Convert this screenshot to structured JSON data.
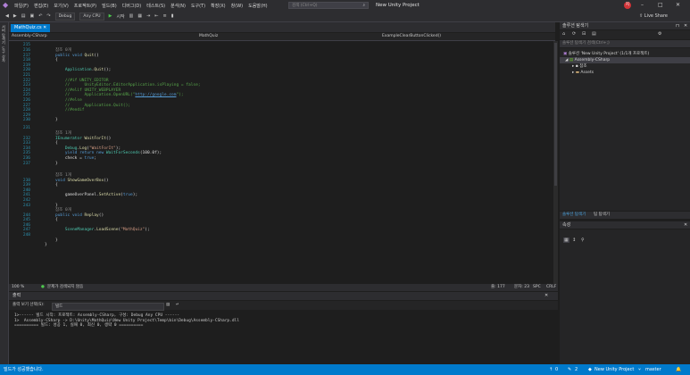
{
  "menubar": {
    "items": [
      "파일(F)",
      "편집(E)",
      "보기(V)",
      "프로젝트(P)",
      "빌드(B)",
      "디버그(D)",
      "테스트(S)",
      "분석(N)",
      "도구(T)",
      "확장(X)",
      "창(W)",
      "도움말(H)"
    ],
    "search_placeholder": "검색 (Ctrl+Q)",
    "project_title": "New Unity Project",
    "avatar_initial": "지"
  },
  "toolbar": {
    "config": "Debug",
    "platform": "Any CPU",
    "start_label": "시작",
    "live_share": "Live Share"
  },
  "left_strip": {
    "items": [
      "서버 탐색기",
      "도구 상자"
    ]
  },
  "editor": {
    "tab_label": "MathQuiz.cs",
    "nav_project": "Assembly-CSharp",
    "nav_class": "MathQuiz",
    "nav_member": "ExampleClearButtonClicked()",
    "line_numbers": [
      215,
      216,
      217,
      218,
      219,
      220,
      221,
      222,
      223,
      224,
      225,
      226,
      227,
      228,
      229,
      230,
      231,
      232,
      233,
      234,
      235,
      236,
      237,
      238,
      239,
      240,
      241,
      242,
      243,
      244,
      245,
      246,
      247,
      248
    ],
    "refs": {
      "quit": "참조 0개",
      "waitfor": "참조 1개",
      "showgameover": "참조 1개",
      "replay": "참조 0개"
    }
  },
  "editor_status": {
    "zoom": "100 %",
    "issues": "문제가 검색되지 않음",
    "line": "줄: 177",
    "col": "문자: 23",
    "spc": "SPC",
    "crlf": "CRLF"
  },
  "output": {
    "title": "출력",
    "source_label": "출력 보기 선택(S):",
    "source_value": "빌드",
    "lines": [
      "1>------ 빌드 시작: 프로젝트: Assembly-CSharp, 구성: Debug Any CPU ------",
      "1>  Assembly-CSharp -> D:\\Unity\\MathQuiz\\New Unity Project\\Temp\\bin\\Debug\\Assembly-CSharp.dll",
      "========== 빌드: 성공 1, 실패 0, 최신 0, 생략 0 =========="
    ]
  },
  "solution_explorer": {
    "title": "솔루션 탐색기",
    "search_placeholder": "솔루션 탐색기 검색(Ctrl+;)",
    "solution": "솔루션 'New Unity Project' (1/1개 프로젝트)",
    "project": "Assembly-CSharp",
    "children": [
      "참조",
      "Assets"
    ],
    "tabs": [
      "솔루션 탐색기",
      "팀 탐색기"
    ]
  },
  "properties": {
    "title": "속성"
  },
  "statusbar": {
    "message": "빌드가 성공했습니다.",
    "up_count": "0",
    "changes": "2",
    "project": "New Unity Project",
    "branch": "master"
  }
}
